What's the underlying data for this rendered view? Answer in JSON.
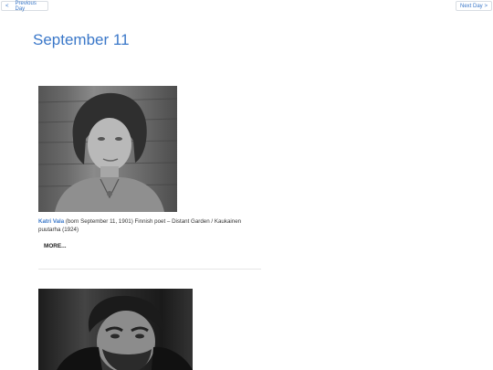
{
  "nav": {
    "prev_arrow": "<",
    "prev_label": "Previous Day",
    "next_label": "Next Day",
    "next_arrow": ">"
  },
  "page": {
    "title": "September 11"
  },
  "entries": [
    {
      "name": "Katri Vala",
      "description": " (born September 11, 1901) Finnish poet – Distant Garden / Kaukainen puutarha (1924)",
      "more_label": "MORE..."
    },
    {
      "name": "",
      "description": "",
      "more_label": ""
    }
  ],
  "colors": {
    "accent": "#3b78c9",
    "text": "#333333",
    "divider": "#e6e6e6"
  }
}
